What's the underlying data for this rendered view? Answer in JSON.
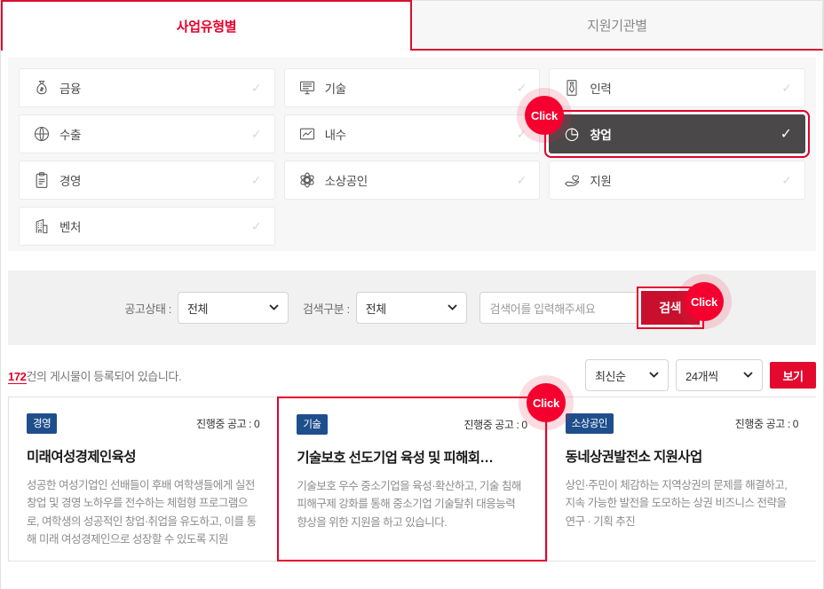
{
  "tabs": [
    {
      "label": "사업유형별",
      "active": true
    },
    {
      "label": "지원기관별",
      "active": false
    }
  ],
  "categories": [
    {
      "label": "금융",
      "icon": "money-bag-icon",
      "selected": false,
      "check": "✓"
    },
    {
      "label": "기술",
      "icon": "monitor-icon",
      "selected": false,
      "check": "✓"
    },
    {
      "label": "인력",
      "icon": "necktie-icon",
      "selected": false,
      "check": "✓"
    },
    {
      "label": "수출",
      "icon": "globe-icon",
      "selected": false,
      "check": "✓"
    },
    {
      "label": "내수",
      "icon": "chart-icon",
      "selected": false,
      "check": "✓"
    },
    {
      "label": "창업",
      "icon": "pie-chart-icon",
      "selected": true,
      "check": "✓"
    },
    {
      "label": "경영",
      "icon": "clipboard-icon",
      "selected": false,
      "check": "✓"
    },
    {
      "label": "소상공인",
      "icon": "atom-icon",
      "selected": false,
      "check": "✓"
    },
    {
      "label": "지원",
      "icon": "hand-heart-icon",
      "selected": false,
      "check": "✓"
    },
    {
      "label": "벤처",
      "icon": "building-icon",
      "selected": false,
      "check": "✓"
    }
  ],
  "click_badges": [
    {
      "label": "Click",
      "target": "category-item-창업"
    },
    {
      "label": "Click",
      "target": "search-button"
    },
    {
      "label": "Click",
      "target": "result-card-2"
    }
  ],
  "filter": {
    "status_label": "공고상태 :",
    "status_value": "전체",
    "type_label": "검색구분 :",
    "type_value": "전체",
    "search_placeholder": "검색어를 입력해주세요",
    "search_value": "",
    "search_button": "검색",
    "chevron": "⌄"
  },
  "results": {
    "count": "172",
    "count_suffix": "건의 게시물이 등록되어 있습니다.",
    "sort_value": "최신순",
    "pagesize_value": "24개씩",
    "view_button": "보기"
  },
  "cards": [
    {
      "badge": "경영",
      "meta": "진행중 공고 : 0",
      "title": "미래여성경제인육성",
      "desc": "성공한 여성기업인 선배들이 후배 여학생들에게 실전창업 및 경영 노하우를 전수하는 체험형 프로그램으로, 여학생의 성공적인 창업·취업을 유도하고, 이를 통해 미래 여성경제인으로 성장할 수 있도록 지원",
      "highlight": false
    },
    {
      "badge": "기술",
      "meta": "진행중 공고 : 0",
      "title": "기술보호 선도기업 육성 및 피해회…",
      "desc": "기술보호 우수 중소기업을 육성·확산하고, 기술 침해 피해구제 강화를 통해 중소기업 기술탈취 대응능력 향상을 위한 지원을 하고 있습니다.",
      "highlight": true
    },
    {
      "badge": "소상공인",
      "meta": "진행중 공고 : 0",
      "title": "동네상권발전소 지원사업",
      "desc": "상인·주민이 체감하는 지역상권의 문제를 해결하고, 지속 가능한 발전을 도모하는 상권 비즈니스 전략을 연구 · 기획 추진",
      "highlight": false
    }
  ],
  "colors": {
    "brand_red": "#e4002b",
    "search_button": "#c8102e",
    "selected_bg": "#4a4849",
    "badge_navy": "#1f4e8c",
    "panel_bg": "#f7f7f7",
    "filter_bg": "#f1f1f1"
  }
}
